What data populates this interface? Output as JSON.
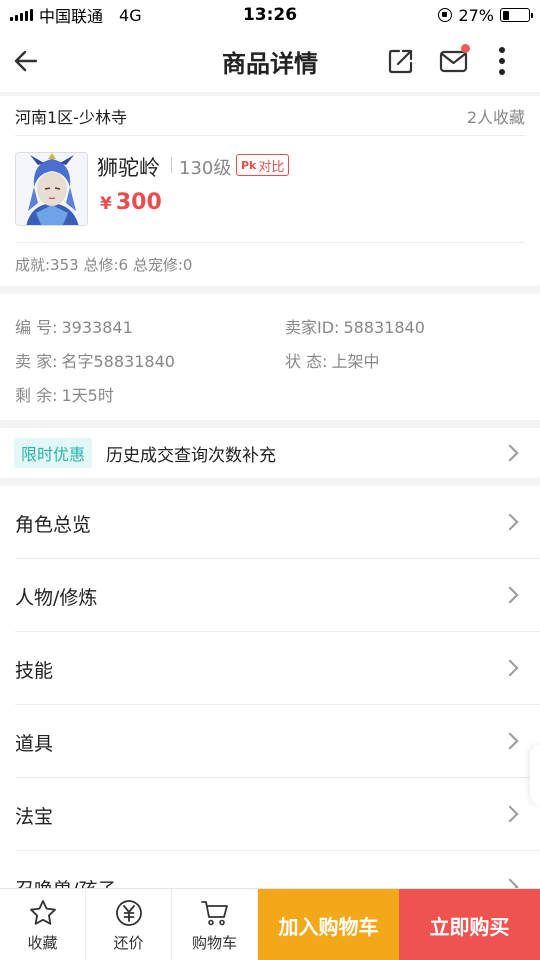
{
  "status_bar": {
    "carrier": "中国联通",
    "network": "4G",
    "time": "13:26",
    "battery": "27%",
    "battery_level": 0.27
  },
  "nav": {
    "title": "商品详情"
  },
  "item": {
    "server": "河南1区-少林寺",
    "favorites": "2人收藏",
    "role_name": "狮驼岭",
    "level": "130级",
    "compare_label": "对比",
    "compare_icon_text": "Pk",
    "currency": "¥",
    "price": "300",
    "stats": "成就:353 总修:6 总宠修:0"
  },
  "info": {
    "id_label": "编 号:",
    "id_value": "3933841",
    "seller_id_label": "卖家ID:",
    "seller_id_value": "58831840",
    "seller_label": "卖 家:",
    "seller_value": "名字58831840",
    "status_label": "状 态:",
    "status_value": "上架中",
    "remaining_label": "剩 余:",
    "remaining_value": "1天5时"
  },
  "promo": {
    "tag": "限时优惠",
    "text": "历史成交查询次数补充"
  },
  "menu": [
    {
      "label": "角色总览"
    },
    {
      "label": "人物/修炼"
    },
    {
      "label": "技能"
    },
    {
      "label": "道具"
    },
    {
      "label": "法宝"
    },
    {
      "label": "召唤兽/孩子"
    }
  ],
  "bottom": {
    "favorite": "收藏",
    "bargain": "还价",
    "cart": "购物车",
    "add_to_cart": "加入购物车",
    "buy_now": "立即购买"
  },
  "colors": {
    "accent_red": "#e94d4d",
    "cart_orange": "#f2a819",
    "buy_red": "#ef5350",
    "promo_teal": "#2bb4ad"
  }
}
